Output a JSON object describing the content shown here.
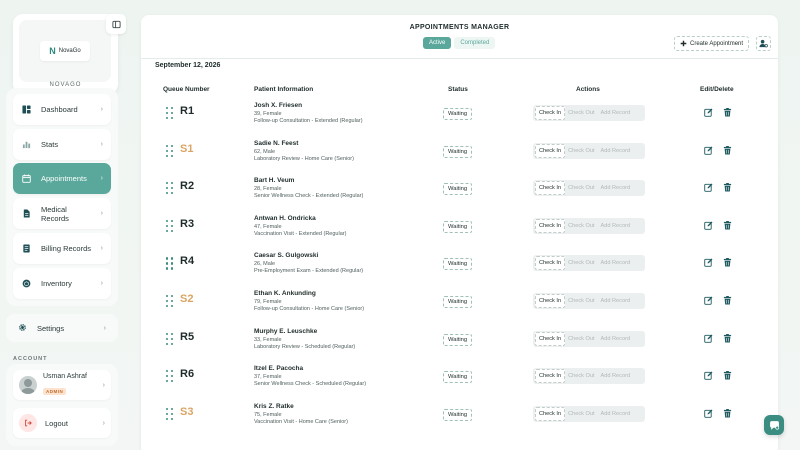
{
  "brand": {
    "logo_mark": "N",
    "logo_text": "NovaGo",
    "caption": "NOVAGO"
  },
  "sidebar": {
    "items": [
      {
        "label": "Dashboard",
        "icon": "dashboard-icon"
      },
      {
        "label": "Stats",
        "icon": "bar-chart-icon"
      },
      {
        "label": "Appointments",
        "icon": "calendar-icon",
        "active": true
      },
      {
        "label_line1": "Medical",
        "label_line2": "Records",
        "icon": "document-icon"
      },
      {
        "label": "Billing Records",
        "icon": "receipt-icon"
      },
      {
        "label": "Inventory",
        "icon": "box-icon"
      }
    ],
    "settings": "Settings",
    "account_label": "ACCOUNT",
    "user": {
      "name": "Usman Ashraf",
      "role": "ADMIN"
    },
    "logout": "Logout",
    "chevron": "›"
  },
  "header": {
    "title": "APPOINTMENTS MANAGER",
    "tabs": [
      {
        "label": "Active",
        "active": true
      },
      {
        "label": "Completed"
      }
    ],
    "create_button": "Create Appointment"
  },
  "date": "September 12, 2026",
  "table": {
    "columns": [
      "Queue Number",
      "Patient Information",
      "Status",
      "Actions",
      "Edit/Delete"
    ],
    "action_labels": [
      "Check In",
      "Check Out",
      "Add Record"
    ],
    "rows": [
      {
        "queue": "R1",
        "type": "regular",
        "name": "Josh X. Friesen",
        "demo": "39, Female",
        "visit": "Follow-up Consultation - Extended (Regular)",
        "status": "Waiting"
      },
      {
        "queue": "S1",
        "type": "senior",
        "name": "Sadie N. Feest",
        "demo": "62, Male",
        "visit": "Laboratory Review - Home Care (Senior)",
        "status": "Waiting"
      },
      {
        "queue": "R2",
        "type": "regular",
        "name": "Bart H. Veum",
        "demo": "28, Female",
        "visit": "Senior Wellness Check - Extended (Regular)",
        "status": "Waiting"
      },
      {
        "queue": "R3",
        "type": "regular",
        "name": "Antwan H. Ondricka",
        "demo": "47, Female",
        "visit": "Vaccination Visit - Extended (Regular)",
        "status": "Waiting"
      },
      {
        "queue": "R4",
        "type": "regular",
        "name": "Caesar S. Gulgowski",
        "demo": "26, Male",
        "visit": "Pre-Employment Exam - Extended (Regular)",
        "status": "Waiting"
      },
      {
        "queue": "S2",
        "type": "senior",
        "name": "Ethan K. Ankunding",
        "demo": "79, Female",
        "visit": "Follow-up Consultation - Home Care (Senior)",
        "status": "Waiting"
      },
      {
        "queue": "R5",
        "type": "regular",
        "name": "Murphy E. Leuschke",
        "demo": "33, Female",
        "visit": "Laboratory Review - Scheduled (Regular)",
        "status": "Waiting"
      },
      {
        "queue": "R6",
        "type": "regular",
        "name": "Itzel E. Pacocha",
        "demo": "37, Female",
        "visit": "Senior Wellness Check - Scheduled (Regular)",
        "status": "Waiting"
      },
      {
        "queue": "S3",
        "type": "senior",
        "name": "Kris Z. Ratke",
        "demo": "75, Female",
        "visit": "Vaccination Visit - Home Care (Senior)",
        "status": "Waiting"
      }
    ]
  },
  "colors": {
    "accent": "#5aa89b",
    "senior": "#d9a565",
    "delete": "#1e5a5f"
  }
}
